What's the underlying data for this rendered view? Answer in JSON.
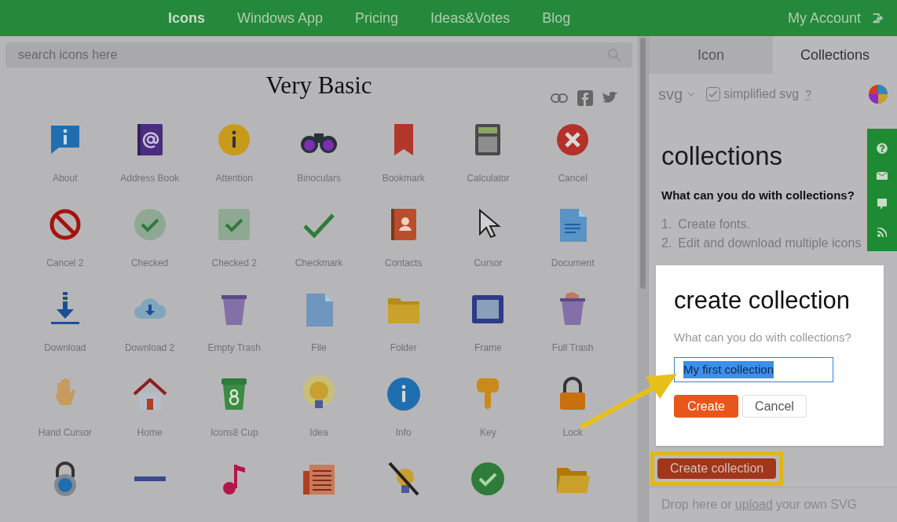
{
  "nav": {
    "items": [
      {
        "label": "Icons",
        "selected": true
      },
      {
        "label": "Windows App",
        "selected": false
      },
      {
        "label": "Pricing",
        "selected": false
      },
      {
        "label": "Ideas&Votes",
        "selected": false
      },
      {
        "label": "Blog",
        "selected": false
      }
    ],
    "account": "My Account"
  },
  "search": {
    "placeholder": "search icons here"
  },
  "category": {
    "title": "Very Basic"
  },
  "icons": [
    {
      "label": "About",
      "kind": "bubble"
    },
    {
      "label": "Address Book",
      "kind": "addressbook"
    },
    {
      "label": "Attention",
      "kind": "attention"
    },
    {
      "label": "Binoculars",
      "kind": "binoculars"
    },
    {
      "label": "Bookmark",
      "kind": "bookmark"
    },
    {
      "label": "Calculator",
      "kind": "calculator"
    },
    {
      "label": "Cancel",
      "kind": "cancel"
    },
    {
      "label": "Cancel 2",
      "kind": "prohibited"
    },
    {
      "label": "Checked",
      "kind": "checkcircle"
    },
    {
      "label": "Checked 2",
      "kind": "checksquare"
    },
    {
      "label": "Checkmark",
      "kind": "checkmark"
    },
    {
      "label": "Contacts",
      "kind": "contacts"
    },
    {
      "label": "Cursor",
      "kind": "cursor"
    },
    {
      "label": "Document",
      "kind": "document"
    },
    {
      "label": "Download",
      "kind": "download"
    },
    {
      "label": "Download 2",
      "kind": "cloud"
    },
    {
      "label": "Empty Trash",
      "kind": "trash"
    },
    {
      "label": "File",
      "kind": "file"
    },
    {
      "label": "Folder",
      "kind": "folder"
    },
    {
      "label": "Frame",
      "kind": "frame"
    },
    {
      "label": "Full Trash",
      "kind": "fulltrash"
    },
    {
      "label": "Hand Cursor",
      "kind": "hand"
    },
    {
      "label": "Home",
      "kind": "home"
    },
    {
      "label": "Icons8 Cup",
      "kind": "cup"
    },
    {
      "label": "Idea",
      "kind": "bulb"
    },
    {
      "label": "Info",
      "kind": "info"
    },
    {
      "label": "Key",
      "kind": "key"
    },
    {
      "label": "Lock",
      "kind": "lock"
    },
    {
      "kind": "combolock"
    },
    {
      "kind": "minus"
    },
    {
      "kind": "music"
    },
    {
      "kind": "newspaper"
    },
    {
      "kind": "nobulb"
    },
    {
      "kind": "greencheck"
    },
    {
      "kind": "openfolder"
    }
  ],
  "panel": {
    "tabs": [
      {
        "label": "Icon",
        "selected": false
      },
      {
        "label": "Collections",
        "selected": true
      }
    ],
    "format": "svg",
    "simplified": {
      "label": "simplified svg",
      "checked": true
    },
    "help": "?",
    "heading": "collections",
    "subheading": "What can you do with collections?",
    "steps": [
      {
        "number": "1.",
        "text": "Create fonts."
      },
      {
        "number": "2.",
        "text": "Edit and download multiple icons"
      }
    ],
    "create_button": "Create collection",
    "drop_text": "Drop here or",
    "drop_link": "upload",
    "drop_rest": "your own SVG"
  },
  "dialog": {
    "title": "create collection",
    "question": "What can you do with collections?",
    "value": "My first collection",
    "value_selected": true,
    "create": "Create",
    "cancel": "Cancel"
  }
}
